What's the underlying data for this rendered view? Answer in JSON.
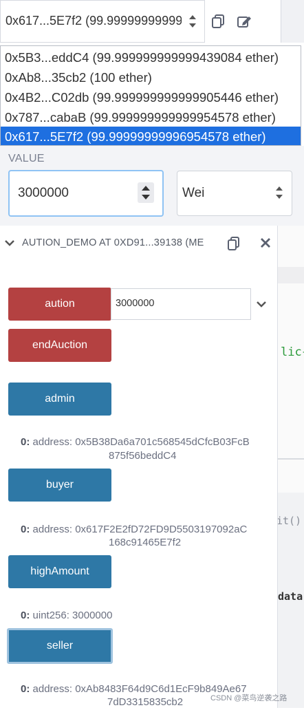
{
  "account": {
    "selected_display": "0x617...5E7f2 (99.99999999999",
    "options": [
      {
        "label": "0x5B3...eddC4 (99.999999999999439084 ether)"
      },
      {
        "label": "0xAb8...35cb2 (100 ether)"
      },
      {
        "label": "0x4B2...C02db (99.999999999999905446 ether)"
      },
      {
        "label": "0x787...cabaB (99.999999999999954578 ether)"
      },
      {
        "label": "0x617...5E7f2 (99.99999999996954578 ether)"
      }
    ],
    "selected_index": 4
  },
  "value": {
    "label": "VALUE",
    "amount": "3000000",
    "unit": "Wei"
  },
  "contract": {
    "title": "AUTION_DEMO AT 0XD91...39138 (ME",
    "functions": [
      {
        "label": "aution",
        "kind": "payable",
        "input": "3000000"
      },
      {
        "label": "endAuction",
        "kind": "transact"
      },
      {
        "label": "admin",
        "kind": "call",
        "output_index": "0:",
        "output_text": "address: 0x5B38Da6a701c568545dCfcB03FcB",
        "output_text_2": "875f56beddC4"
      },
      {
        "label": "buyer",
        "kind": "call",
        "output_index": "0:",
        "output_text": "address: 0x617F2E2fD72FD9D5503197092aC",
        "output_text_2": "168c91465E7f2"
      },
      {
        "label": "highAmount",
        "kind": "call",
        "output_index": "0:",
        "output_text": "uint256: 3000000"
      },
      {
        "label": "seller",
        "kind": "call",
        "output_index": "0:",
        "output_text": "address: 0xAb8483F64d9C6d1EcF9b849Ae67",
        "output_text_2": "7dD3315835cb2"
      }
    ]
  },
  "editor_fragment": {
    "line1": "lic{",
    "line2": "it() {",
    "line3": "data"
  },
  "watermark": "CSDN @菜鸟逆袭之路",
  "colors": {
    "transact_red": "#b44141",
    "call_blue": "#2e78a6",
    "selected_option": "#1e6fe0"
  }
}
